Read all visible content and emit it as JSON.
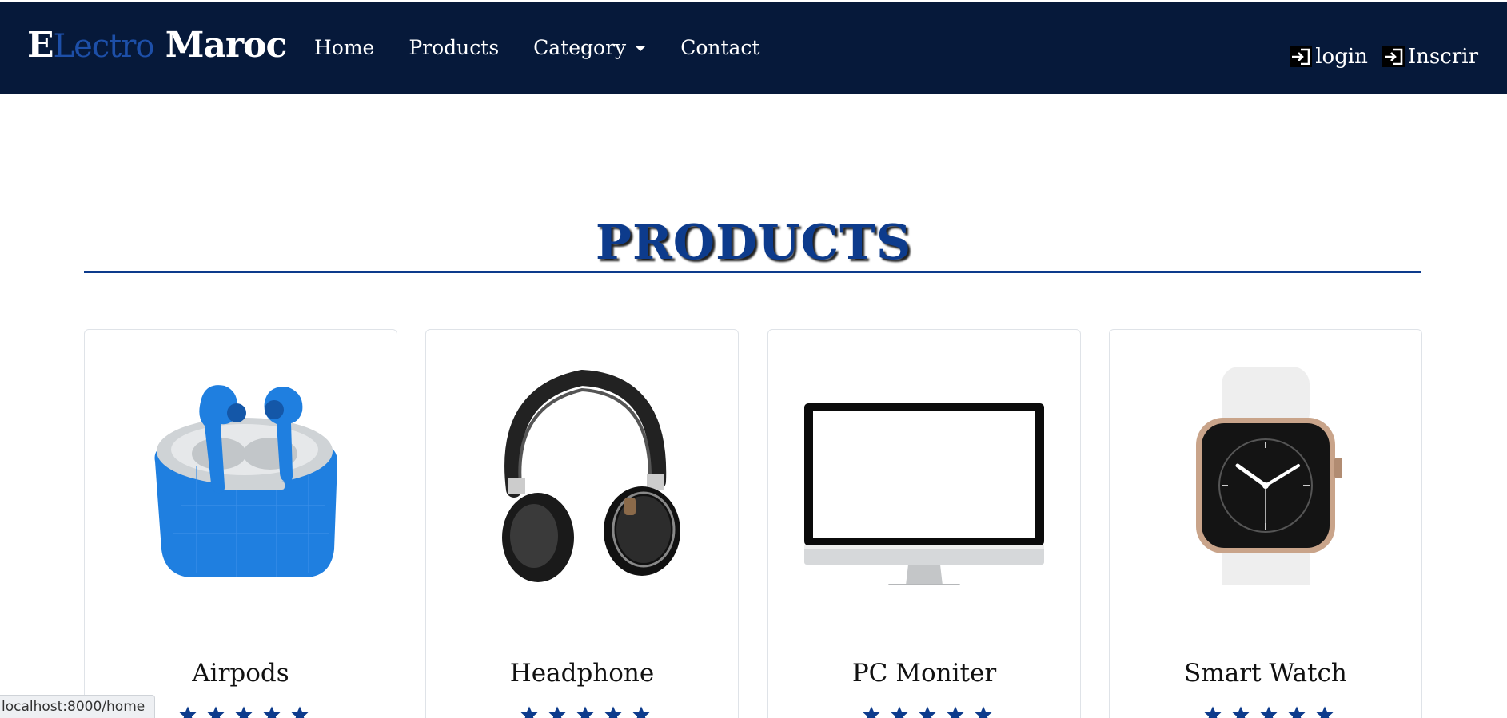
{
  "brand": {
    "part1": "E",
    "part2": "Lectro",
    "part3": " Maroc"
  },
  "nav": {
    "home": "Home",
    "products": "Products",
    "category": "Category",
    "contact": "Contact"
  },
  "auth": {
    "login": "login",
    "signup": "Inscrir"
  },
  "section": {
    "title": "PRODUCTS"
  },
  "products": [
    {
      "name": "Airpods",
      "rating": 5,
      "image": "airpods-image"
    },
    {
      "name": "Headphone",
      "rating": 5,
      "image": "headphone-image"
    },
    {
      "name": "PC Moniter",
      "rating": 5,
      "image": "monitor-image"
    },
    {
      "name": "Smart Watch",
      "rating": 5,
      "image": "smartwatch-image"
    }
  ],
  "status": {
    "url": "localhost:8000/home"
  },
  "colors": {
    "navbar": "#06193a",
    "accent": "#0d3b8c",
    "brand_blue": "#1d4fa8",
    "star": "#0d3b8c"
  }
}
